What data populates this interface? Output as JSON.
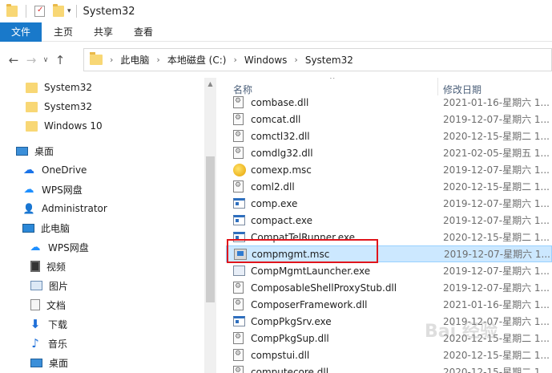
{
  "window": {
    "title": "System32"
  },
  "ribbon": {
    "tabs": [
      "文件",
      "主页",
      "共享",
      "查看"
    ]
  },
  "address": {
    "crumbs": [
      "此电脑",
      "本地磁盘 (C:)",
      "Windows",
      "System32"
    ]
  },
  "nav": {
    "items": [
      {
        "label": "System32",
        "icon": "folder-icon"
      },
      {
        "label": "System32",
        "icon": "folder-icon"
      },
      {
        "label": "Windows 10",
        "icon": "folder-icon"
      },
      {
        "label": "桌面",
        "icon": "desktop-icon"
      },
      {
        "label": "OneDrive",
        "icon": "cloud-icon"
      },
      {
        "label": "WPS网盘",
        "icon": "wps-cloud-icon"
      },
      {
        "label": "Administrator",
        "icon": "user-icon"
      },
      {
        "label": "此电脑",
        "icon": "pc-icon"
      },
      {
        "label": "WPS网盘",
        "icon": "wps-cloud-icon"
      },
      {
        "label": "视频",
        "icon": "video-icon"
      },
      {
        "label": "图片",
        "icon": "picture-icon"
      },
      {
        "label": "文档",
        "icon": "document-icon"
      },
      {
        "label": "下载",
        "icon": "download-icon"
      },
      {
        "label": "音乐",
        "icon": "music-icon"
      },
      {
        "label": "桌面",
        "icon": "desktop-icon"
      }
    ]
  },
  "files": {
    "columns": {
      "name": "名称",
      "date": "修改日期"
    },
    "rows": [
      {
        "name": "combase.dll",
        "date": "2021-01-16-星期六 1...",
        "type": "dll"
      },
      {
        "name": "comcat.dll",
        "date": "2019-12-07-星期六 1...",
        "type": "dll"
      },
      {
        "name": "comctl32.dll",
        "date": "2020-12-15-星期二 1...",
        "type": "dll"
      },
      {
        "name": "comdlg32.dll",
        "date": "2021-02-05-星期五 1...",
        "type": "dll"
      },
      {
        "name": "comexp.msc",
        "date": "2019-12-07-星期六 1...",
        "type": "comexp"
      },
      {
        "name": "coml2.dll",
        "date": "2020-12-15-星期二 1...",
        "type": "dll"
      },
      {
        "name": "comp.exe",
        "date": "2019-12-07-星期六 1...",
        "type": "exe"
      },
      {
        "name": "compact.exe",
        "date": "2019-12-07-星期六 1...",
        "type": "exe"
      },
      {
        "name": "CompatTelRunner.exe",
        "date": "2020-12-15-星期二 1...",
        "type": "exe"
      },
      {
        "name": "compmgmt.msc",
        "date": "2019-12-07-星期六 1...",
        "type": "msc",
        "selected": true
      },
      {
        "name": "CompMgmtLauncher.exe",
        "date": "2019-12-07-星期六 1...",
        "type": "mgmtexe"
      },
      {
        "name": "ComposableShellProxyStub.dll",
        "date": "2019-12-07-星期六 1...",
        "type": "dll"
      },
      {
        "name": "ComposerFramework.dll",
        "date": "2021-01-16-星期六 1...",
        "type": "dll"
      },
      {
        "name": "CompPkgSrv.exe",
        "date": "2019-12-07-星期六 1...",
        "type": "exe"
      },
      {
        "name": "CompPkgSup.dll",
        "date": "2020-12-15-星期二 1...",
        "type": "dll"
      },
      {
        "name": "compstui.dll",
        "date": "2020-12-15-星期二 1...",
        "type": "dll"
      },
      {
        "name": "computecore.dll",
        "date": "2020-12-15-星期二 1...",
        "type": "dll"
      }
    ]
  },
  "colors": {
    "accent": "#1979ca",
    "selection": "#cce8ff",
    "highlight_border": "#e0151b"
  },
  "watermark": "Bai 经验"
}
